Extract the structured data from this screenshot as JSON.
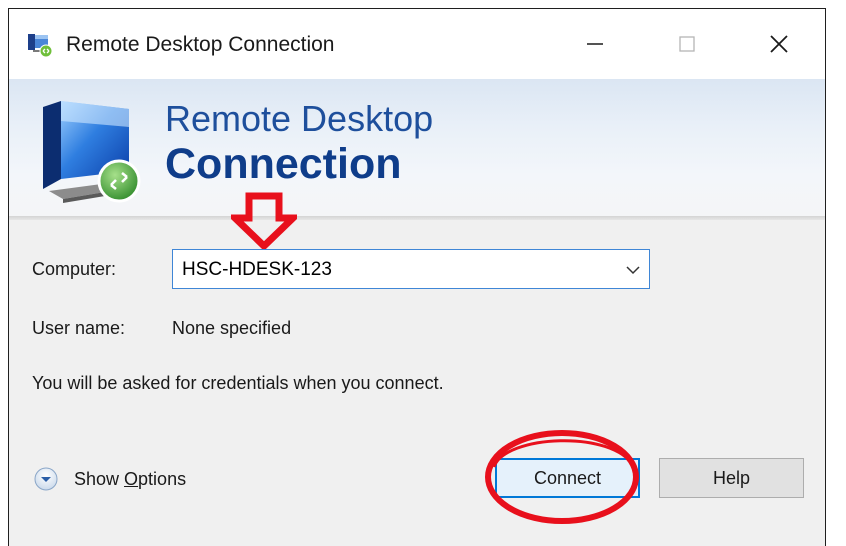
{
  "window": {
    "title": "Remote Desktop Connection",
    "icon": "remote-desktop-icon"
  },
  "banner": {
    "line1": "Remote Desktop",
    "line2": "Connection",
    "logo": "monitor-connection-logo"
  },
  "form": {
    "computer_label": "Computer:",
    "computer_value": "HSC-HDESK-123",
    "username_label": "User name:",
    "username_value": "None specified",
    "info_text": "You will be asked for credentials when you connect."
  },
  "footer": {
    "show_options_prefix": "Show ",
    "show_options_underlined": "O",
    "show_options_suffix": "ptions",
    "connect_label": "Connect",
    "help_label": "Help"
  },
  "annotations": {
    "arrow_color": "#e8101c",
    "circle_color": "#e8101c"
  },
  "colors": {
    "accent": "#0078d7",
    "banner_text": "#1e4f9c"
  }
}
